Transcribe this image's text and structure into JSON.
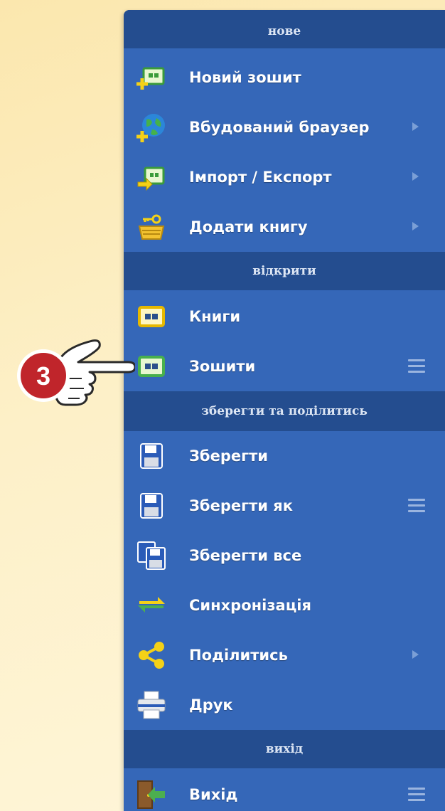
{
  "sections": {
    "new": "нове",
    "open": "відкрити",
    "save_share": "зберегти та поділитись",
    "exit": "вихід"
  },
  "items": {
    "new_notebook": "Новий зошит",
    "browser": "Вбудований браузер",
    "import_export": "Імпорт / Експорт",
    "add_book": "Додати книгу",
    "books": "Книги",
    "notebooks": "Зошити",
    "save": "Зберегти",
    "save_as": "Зберегти як",
    "save_all": "Зберегти все",
    "sync": "Синхронізація",
    "share": "Поділитись",
    "print": "Друк",
    "exit": "Вихід"
  },
  "callout": {
    "step_number": "3"
  },
  "colors": {
    "menu_bg": "#3567b8",
    "header_bg": "#244d8f",
    "callout_red": "#c0252b"
  }
}
